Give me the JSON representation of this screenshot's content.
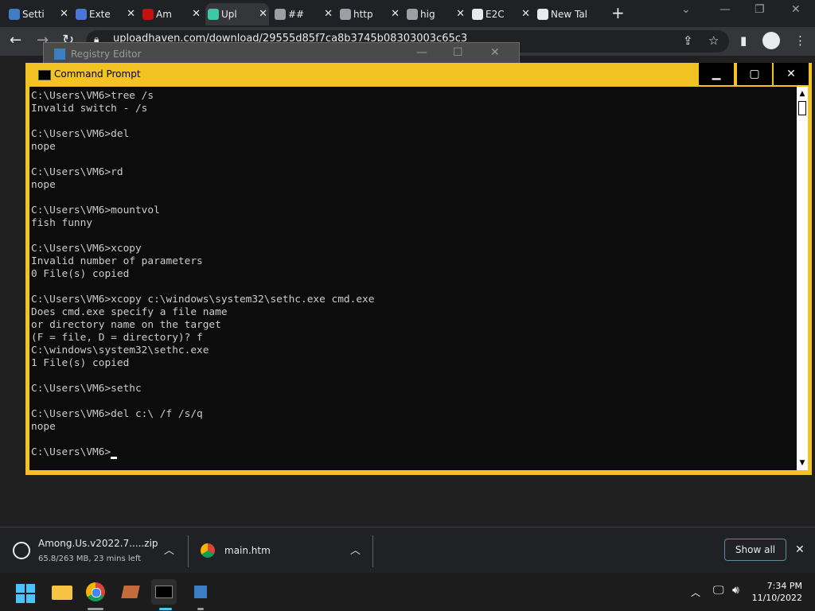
{
  "browser": {
    "tabs": [
      {
        "label": "Setti",
        "icon": "gear-icon"
      },
      {
        "label": "Exte",
        "icon": "puzzle-icon"
      },
      {
        "label": "Am",
        "icon": "amongus-icon"
      },
      {
        "label": "Upl",
        "icon": "cloud-icon"
      },
      {
        "label": "##",
        "icon": "globe-icon"
      },
      {
        "label": "http",
        "icon": "globe-icon"
      },
      {
        "label": "hig",
        "icon": "globe-icon"
      },
      {
        "label": "E2C",
        "icon": "grid-icon"
      },
      {
        "label": "New Tal",
        "icon": "chrome-icon"
      }
    ],
    "url": "uploadhaven.com/download/29555d85f7ca8b3745b08303003c65c3"
  },
  "registry": {
    "title": "Registry Editor"
  },
  "cmd": {
    "title": "Command Prompt",
    "lines": [
      "",
      "C:\\Users\\VM6>tree /s",
      "Invalid switch - /s",
      "",
      "C:\\Users\\VM6>del",
      "nope",
      "",
      "C:\\Users\\VM6>rd",
      "nope",
      "",
      "C:\\Users\\VM6>mountvol",
      "fish funny",
      "",
      "C:\\Users\\VM6>xcopy",
      "Invalid number of parameters",
      "0 File(s) copied",
      "",
      "C:\\Users\\VM6>xcopy c:\\windows\\system32\\sethc.exe cmd.exe",
      "Does cmd.exe specify a file name",
      "or directory name on the target",
      "(F = file, D = directory)? f",
      "C:\\windows\\system32\\sethc.exe",
      "1 File(s) copied",
      "",
      "C:\\Users\\VM6>sethc",
      "",
      "C:\\Users\\VM6>del c:\\ /f /s/q",
      "nope",
      "",
      "C:\\Users\\VM6>"
    ]
  },
  "downloads": {
    "items": [
      {
        "name": "Among.Us.v2022.7.....zip",
        "status": "65.8/263 MB, 23 mins left"
      },
      {
        "name": "main.htm",
        "status": ""
      }
    ],
    "show_all": "Show all"
  },
  "taskbar": {
    "time": "7:34 PM",
    "date": "11/10/2022"
  }
}
